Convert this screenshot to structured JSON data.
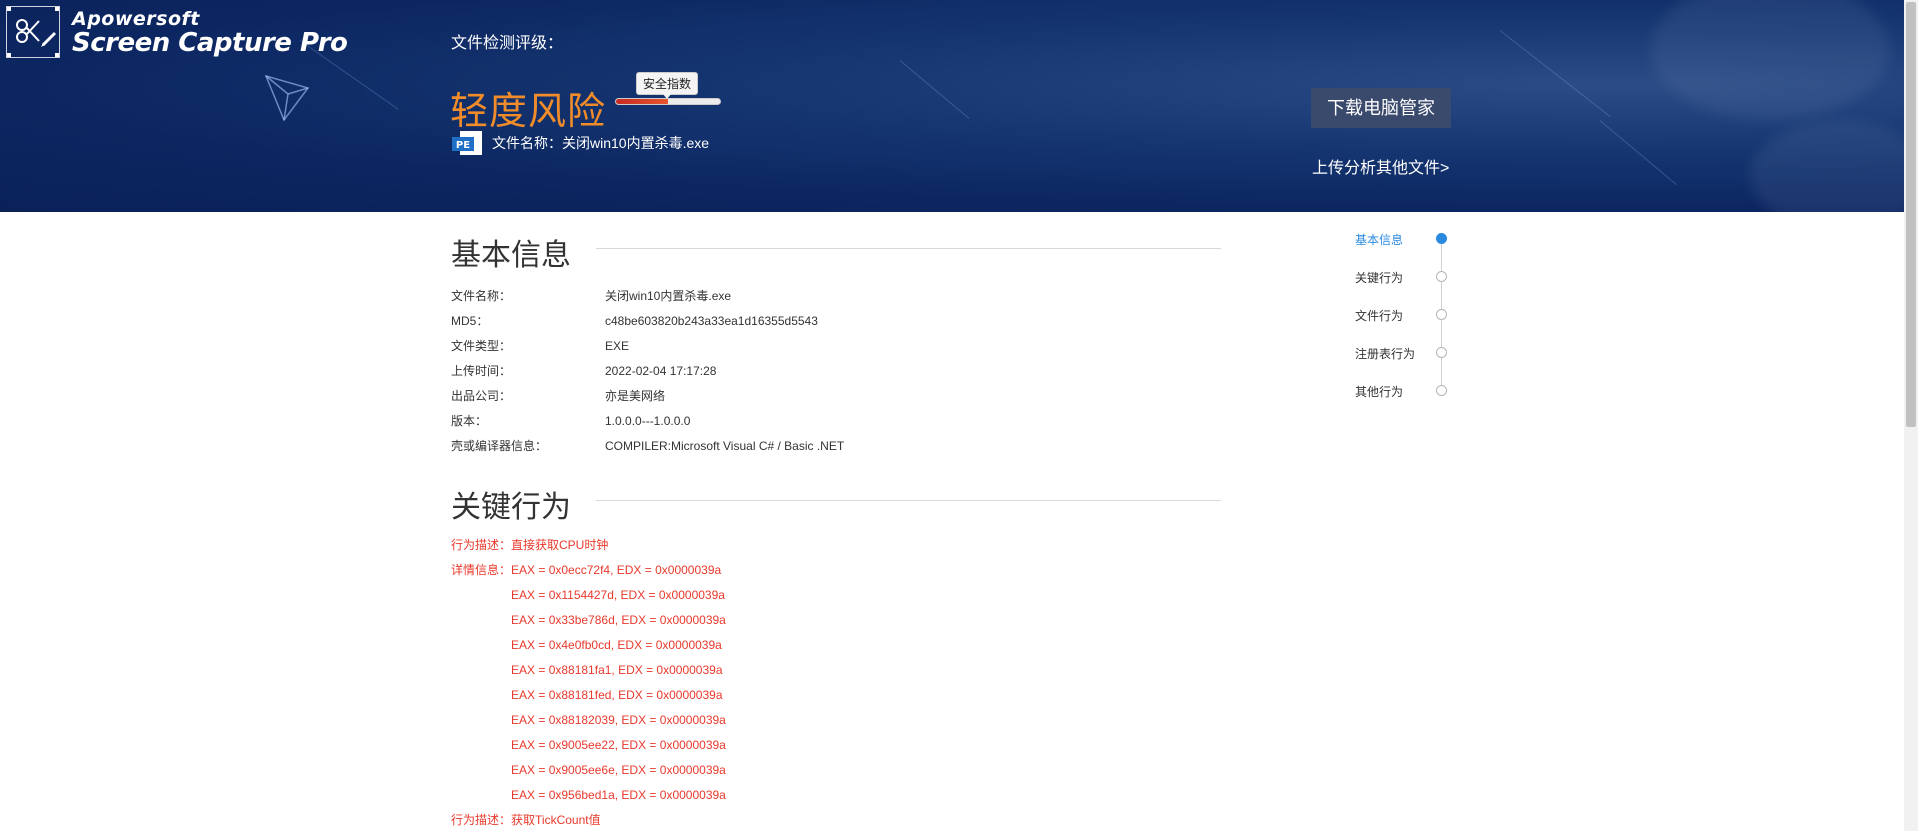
{
  "watermark": {
    "brand": "Apowersoft",
    "product": "Screen Capture Pro"
  },
  "header": {
    "eval_label": "文件检测评级：",
    "risk_level": "轻度风险",
    "safety_tag": "安全指数",
    "risk_level_fraction": 0.5,
    "file_name_label": "文件名称：",
    "file_name": "关闭win10内置杀毒.exe",
    "pe_icon_text": "PE",
    "download_button": "下载电脑管家",
    "upload_link": "上传分析其他文件>"
  },
  "basic_info": {
    "title": "基本信息",
    "rows": [
      {
        "key": "文件名称：",
        "value": "关闭win10内置杀毒.exe"
      },
      {
        "key": "MD5：",
        "value": "c48be603820b243a33ea1d16355d5543"
      },
      {
        "key": "文件类型：",
        "value": "EXE"
      },
      {
        "key": "上传时间：",
        "value": "2022-02-04 17:17:28"
      },
      {
        "key": "出品公司：",
        "value": "亦是美网络"
      },
      {
        "key": "版本：",
        "value": "1.0.0.0---1.0.0.0"
      },
      {
        "key": "壳或编译器信息：",
        "value": "COMPILER:Microsoft Visual C# / Basic .NET"
      }
    ]
  },
  "key_behavior": {
    "title": "关键行为",
    "desc_label": "行为描述：",
    "desc_1": "直接获取CPU时钟",
    "detail_label": "详情信息：",
    "details": [
      "EAX = 0x0ecc72f4, EDX = 0x0000039a",
      "EAX = 0x1154427d, EDX = 0x0000039a",
      "EAX = 0x33be786d, EDX = 0x0000039a",
      "EAX = 0x4e0fb0cd, EDX = 0x0000039a",
      "EAX = 0x88181fa1, EDX = 0x0000039a",
      "EAX = 0x88181fed, EDX = 0x0000039a",
      "EAX = 0x88182039, EDX = 0x0000039a",
      "EAX = 0x9005ee22, EDX = 0x0000039a",
      "EAX = 0x9005ee6e, EDX = 0x0000039a",
      "EAX = 0x956bed1a, EDX = 0x0000039a"
    ],
    "desc_2": "获取TickCount值"
  },
  "sidenav": {
    "items": [
      {
        "label": "基本信息",
        "active": true
      },
      {
        "label": "关键行为",
        "active": false
      },
      {
        "label": "文件行为",
        "active": false
      },
      {
        "label": "注册表行为",
        "active": false
      },
      {
        "label": "其他行为",
        "active": false
      }
    ]
  },
  "colors": {
    "header_bg": "#0c2661",
    "risk_orange": "#f08c2a",
    "behavior_red": "#e8392c",
    "nav_active": "#2a8ae0"
  }
}
